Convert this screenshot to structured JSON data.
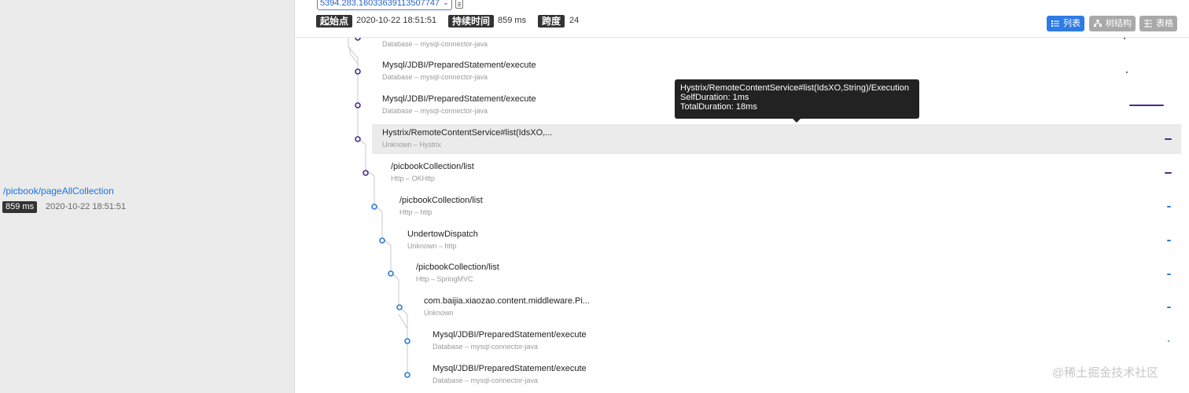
{
  "left_panel": {
    "trace_endpoint": "/picbook/pageAllCollection",
    "trace_duration": "859 ms",
    "trace_start": "2020-10-22 18:51:51"
  },
  "header": {
    "trace_id": "5394.283.16033639113507747",
    "start_label": "起始点",
    "start_value": "2020-10-22 18:51:51",
    "duration_label": "持续时间",
    "duration_value": "859 ms",
    "span_label": "跨度",
    "span_value": "24",
    "views": {
      "list": "列表",
      "tree": "树结构",
      "table": "表格"
    },
    "active_view": "list"
  },
  "spans": [
    {
      "title": "",
      "subtitle": "Database – mysql-connector-java"
    },
    {
      "title": "Mysql/JDBI/PreparedStatement/execute",
      "subtitle": "Database – mysql-connector-java"
    },
    {
      "title": "Mysql/JDBI/PreparedStatement/execute",
      "subtitle": "Database – mysql-connector-java"
    },
    {
      "title": "Hystrix/RemoteContentService#list(IdsXO,...",
      "subtitle": "Unknown – Hystrix",
      "selected": true
    },
    {
      "title": "/picbookCollection/list",
      "subtitle": "Http – OKHttp"
    },
    {
      "title": "/picbookCollection/list",
      "subtitle": "Http – http"
    },
    {
      "title": "UndertowDispatch",
      "subtitle": "Unknown – http"
    },
    {
      "title": "/picbookCollection/list",
      "subtitle": "Http – SpringMVC"
    },
    {
      "title": "com.baijia.xiaozao.content.middleware.Pi...",
      "subtitle": "Unknown"
    },
    {
      "title": "Mysql/JDBI/PreparedStatement/execute",
      "subtitle": "Database – mysql-connector-java"
    },
    {
      "title": "Mysql/JDBI/PreparedStatement/execute",
      "subtitle": "Database – mysql-connector-java"
    }
  ],
  "tooltip": {
    "name": "Hystrix/RemoteContentService#list(IdsXO,String)/Execution",
    "self_duration": "SelfDuration: 1ms",
    "total_duration": "TotalDuration: 18ms"
  },
  "watermark": "@稀土掘金技术社区",
  "colors": {
    "accent": "#2d7be5",
    "purple": "#4b2a8c",
    "blue": "#2a7bd4",
    "header_tag": "#333333"
  }
}
